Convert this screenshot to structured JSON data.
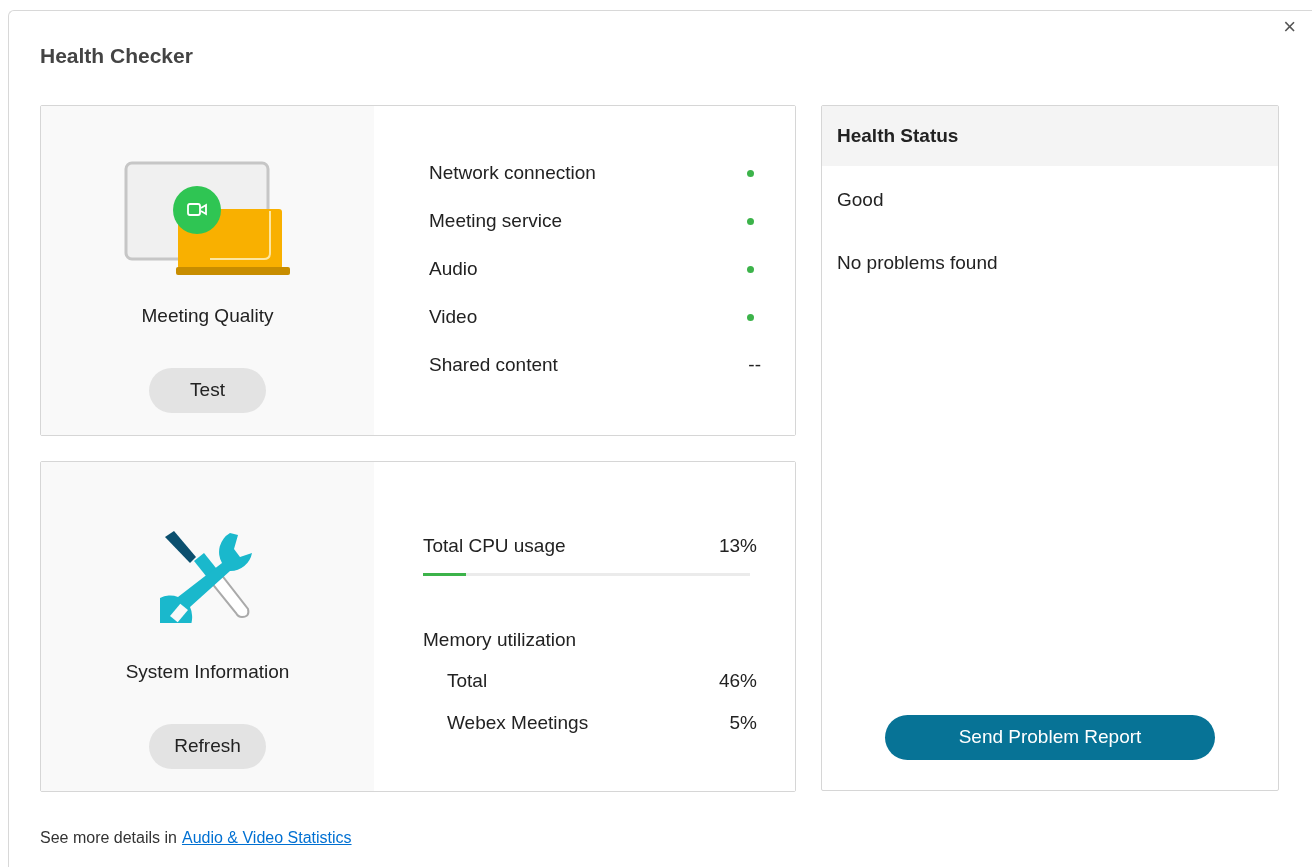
{
  "window": {
    "title": "Health Checker",
    "close": "×"
  },
  "meeting_quality": {
    "title": "Meeting Quality",
    "button": "Test",
    "checks": [
      {
        "label": "Network connection",
        "kind": "dot"
      },
      {
        "label": "Meeting service",
        "kind": "dot"
      },
      {
        "label": "Audio",
        "kind": "dot"
      },
      {
        "label": "Video",
        "kind": "dot"
      },
      {
        "label": "Shared content",
        "kind": "text",
        "value": "--"
      }
    ]
  },
  "system_information": {
    "title": "System Information",
    "button": "Refresh",
    "cpu": {
      "label": "Total CPU usage",
      "reading": "13%",
      "level": 0.13
    },
    "memory": {
      "label": "Memory utilization",
      "rows": [
        {
          "label": "Total",
          "reading": "46%"
        },
        {
          "label": "Webex Meetings",
          "reading": "5%"
        }
      ]
    }
  },
  "health_status": {
    "title": "Health Status",
    "status": "Good",
    "message": "No problems found",
    "button": "Send Problem Report"
  },
  "footer": {
    "text": "See more details in",
    "link": "Audio & Video Statistics"
  }
}
